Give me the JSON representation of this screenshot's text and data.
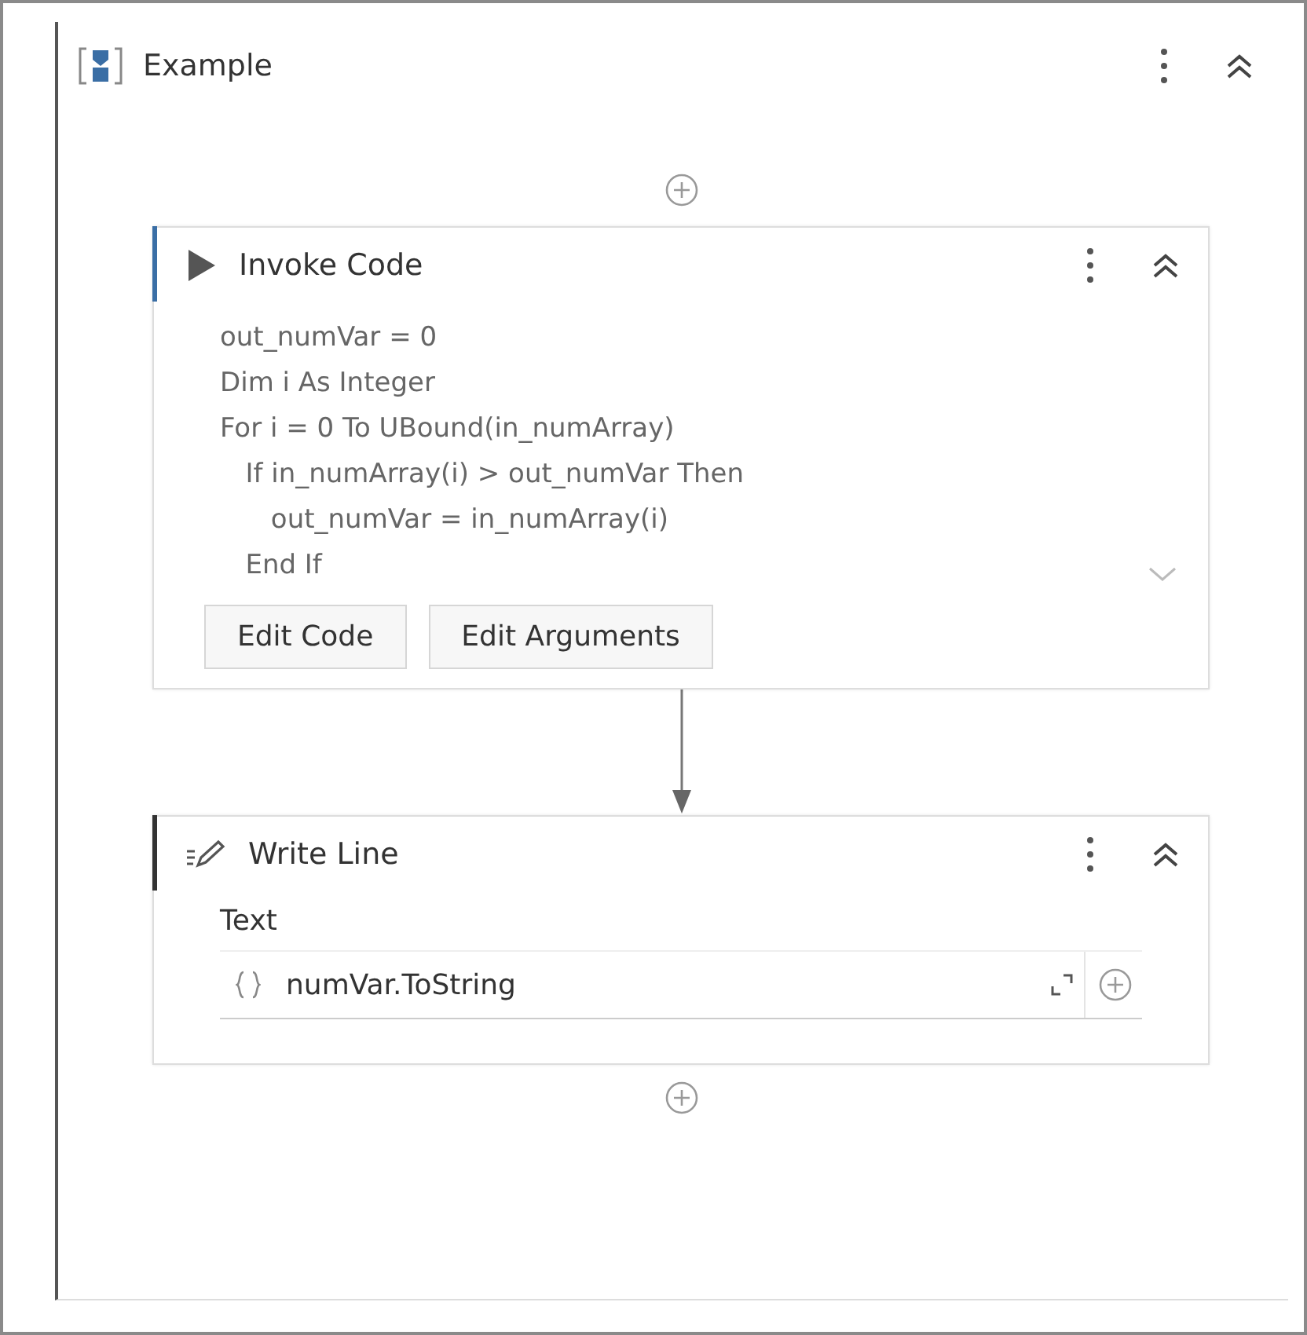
{
  "sequence": {
    "title": "Example"
  },
  "invoke_code": {
    "title": "Invoke Code",
    "code": "out_numVar = 0\nDim i As Integer\nFor i = 0 To UBound(in_numArray)\n   If in_numArray(i) > out_numVar Then\n      out_numVar = in_numArray(i)\n   End If",
    "buttons": [
      "Edit Code",
      "Edit Arguments"
    ]
  },
  "write_line": {
    "title": "Write Line",
    "field_label": "Text",
    "value": "numVar.ToString"
  }
}
